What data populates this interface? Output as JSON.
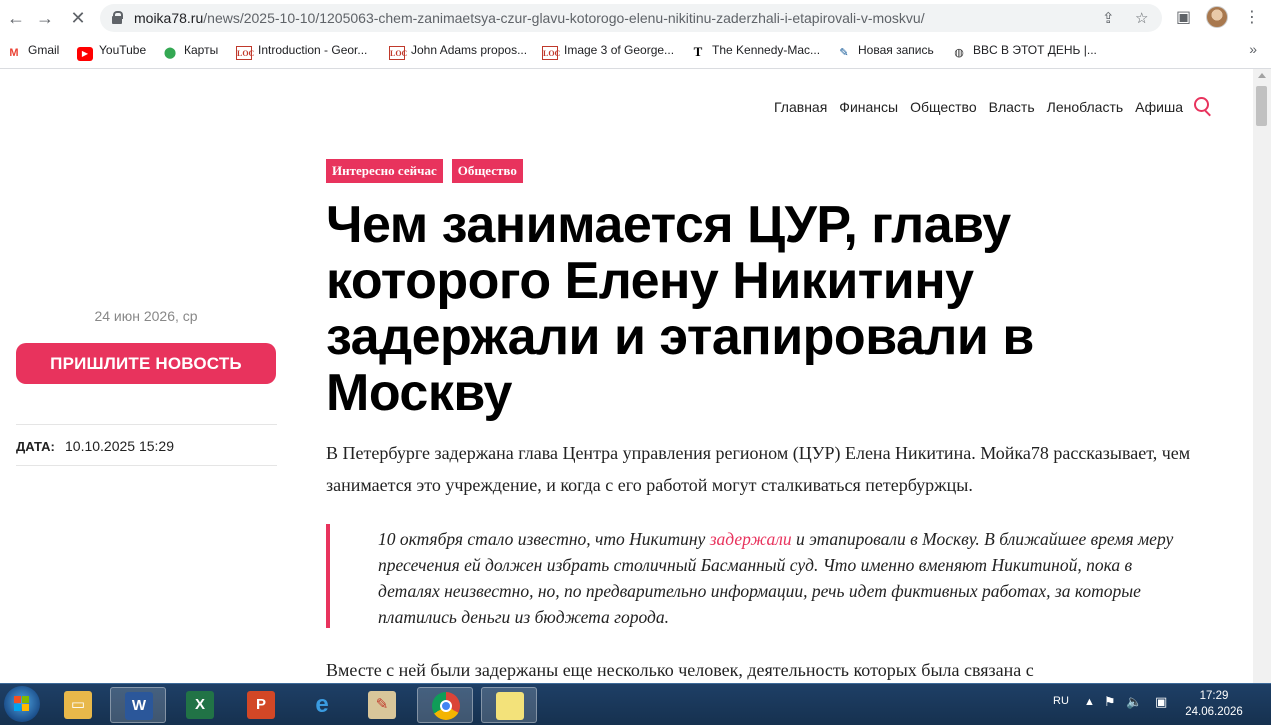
{
  "browser": {
    "url_host": "moika78.ru",
    "url_path": "/news/2025-10-10/1205063-chem-zanimaetsya-czur-glavu-kotorogo-elenu-nikitinu-zaderzhali-i-etapirovali-v-moskvu/",
    "bookmarks": [
      {
        "label": "Gmail",
        "icon": "gmail-icon"
      },
      {
        "label": "YouTube",
        "icon": "youtube-icon"
      },
      {
        "label": "Карты",
        "icon": "maps-icon"
      },
      {
        "label": "Introduction - Geor...",
        "icon": "loc-icon"
      },
      {
        "label": "John Adams propos...",
        "icon": "loc-icon"
      },
      {
        "label": "Image 3 of George...",
        "icon": "loc-icon"
      },
      {
        "label": "The Kennedy-Mac...",
        "icon": "nyt-icon"
      },
      {
        "label": "Новая запись",
        "icon": "livejournal-icon"
      },
      {
        "label": "BBC В ЭТОТ ДЕНЬ |...",
        "icon": "globe-icon"
      }
    ]
  },
  "site": {
    "nav": [
      "Главная",
      "Финансы",
      "Общество",
      "Власть",
      "Ленобласть",
      "Афиша"
    ],
    "accent_color": "#e8335d"
  },
  "sidebar": {
    "today": "24 июн 2026, ср",
    "send_news_label": "ПРИШЛИТЕ НОВОСТЬ",
    "date_label": "ДАТА:",
    "date_value": "10.10.2025 15:29"
  },
  "article": {
    "tags": [
      "Интересно сейчас",
      "Общество"
    ],
    "title": "Чем занимается ЦУР, главу которого Елену Никитину задержали и этапировали в Москву",
    "lead": "В Петербурге задержана глава Центра управления регионом (ЦУР) Елена Никитина. Мойка78 рассказывает, чем занимается это учреждение, и когда с его работой могут сталкиваться петербуржцы.",
    "quote_before": "10 октября стало известно, что Никитину ",
    "quote_link": "задержали",
    "quote_after": " и этапировали в Москву. В ближайшее время меру пресечения ей должен избрать столичный Басманный суд. Что именно вменяют Никитиной, пока в деталях неизвестно, но, по предварительно информации, речь идет фиктивных работах, за которые платились деньги из бюджета города.",
    "para2": "Вместе с ней были задержаны еще несколько человек, деятельность которых была связана с"
  },
  "taskbar": {
    "lang": "RU",
    "time": "17:29",
    "date": "24.06.2026"
  }
}
